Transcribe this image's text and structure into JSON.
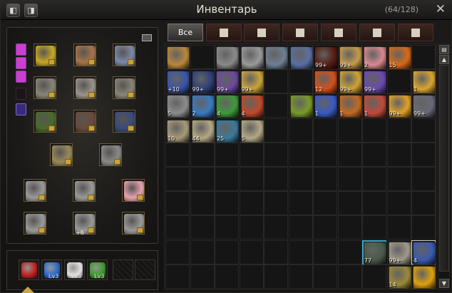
{
  "window": {
    "title": "Инвентарь",
    "capacity": "(64/128)",
    "close_glyph": "✕",
    "left_button_glyph": "◧",
    "right_button_glyph": "◨"
  },
  "tabs": [
    {
      "label": "Все",
      "icon": "all-items",
      "active": true
    },
    {
      "label": "",
      "icon": "helmet-icon",
      "active": false
    },
    {
      "label": "",
      "icon": "potion-icon",
      "active": false
    },
    {
      "label": "",
      "icon": "scroll-icon",
      "active": false
    },
    {
      "label": "",
      "icon": "box-icon",
      "active": false
    },
    {
      "label": "",
      "icon": "key-icon",
      "active": false
    },
    {
      "label": "",
      "icon": "crystal-icon",
      "active": false
    }
  ],
  "inventory": [
    {
      "r": 0,
      "c": 0,
      "color": "#b9873a",
      "qty": ""
    },
    {
      "r": 0,
      "c": 2,
      "color": "#8a8a8a",
      "qty": ""
    },
    {
      "r": 0,
      "c": 3,
      "color": "#9a9a9a",
      "qty": ""
    },
    {
      "r": 0,
      "c": 4,
      "color": "#6f7f92",
      "qty": ""
    },
    {
      "r": 0,
      "c": 5,
      "color": "#5a6fa2",
      "qty": ""
    },
    {
      "r": 0,
      "c": 6,
      "color": "#5a1f14",
      "qty": "99+"
    },
    {
      "r": 0,
      "c": 7,
      "color": "#c89b4a",
      "qty": "99+"
    },
    {
      "r": 0,
      "c": 8,
      "color": "#d88a8f",
      "qty": "2"
    },
    {
      "r": 0,
      "c": 9,
      "color": "#d86a18",
      "qty": "15"
    },
    {
      "r": 1,
      "c": 0,
      "color": "#3b55a8",
      "qty": "+10"
    },
    {
      "r": 1,
      "c": 1,
      "color": "#2f3f7a",
      "qty": "99+"
    },
    {
      "r": 1,
      "c": 2,
      "color": "#6a4a9a",
      "qty": "99+"
    },
    {
      "r": 1,
      "c": 3,
      "color": "#caa43a",
      "qty": "99+"
    },
    {
      "r": 1,
      "c": 6,
      "color": "#d4501a",
      "qty": "12"
    },
    {
      "r": 1,
      "c": 7,
      "color": "#cfa236",
      "qty": "99+"
    },
    {
      "r": 1,
      "c": 8,
      "color": "#6a4ab0",
      "qty": "99+"
    },
    {
      "r": 1,
      "c": 10,
      "color": "#d9a52f",
      "qty": "1"
    },
    {
      "r": 2,
      "c": 0,
      "color": "#8c8c8c",
      "qty": "5"
    },
    {
      "r": 2,
      "c": 1,
      "color": "#3a7ac0",
      "qty": "2"
    },
    {
      "r": 2,
      "c": 2,
      "color": "#3f9a3a",
      "qty": "4"
    },
    {
      "r": 2,
      "c": 3,
      "color": "#c04a2a",
      "qty": "4"
    },
    {
      "r": 2,
      "c": 5,
      "color": "#7a9a2a",
      "qty": ""
    },
    {
      "r": 2,
      "c": 6,
      "color": "#3a5ac0",
      "qty": "1"
    },
    {
      "r": 2,
      "c": 7,
      "color": "#c46a22",
      "qty": "1"
    },
    {
      "r": 2,
      "c": 8,
      "color": "#c04a3a",
      "qty": "1"
    },
    {
      "r": 2,
      "c": 9,
      "color": "#e0a02a",
      "qty": "99+"
    },
    {
      "r": 2,
      "c": 10,
      "color": "#6a6a78",
      "qty": "99+"
    },
    {
      "r": 3,
      "c": 0,
      "color": "#a89a7a",
      "qty": "10"
    },
    {
      "r": 3,
      "c": 1,
      "color": "#b4a884",
      "qty": "44"
    },
    {
      "r": 3,
      "c": 2,
      "color": "#3a7a9a",
      "qty": "25"
    },
    {
      "r": 3,
      "c": 3,
      "color": "#b4a884",
      "qty": "5"
    },
    {
      "r": 8,
      "c": 8,
      "color": "#4a5a4a",
      "qty": "77"
    },
    {
      "r": 8,
      "c": 9,
      "color": "#a09a8a",
      "qty": "99+"
    },
    {
      "r": 8,
      "c": 10,
      "color": "#3a5ab0",
      "qty": "4"
    },
    {
      "r": 9,
      "c": 9,
      "color": "#9a8a3a",
      "qty": "14"
    },
    {
      "r": 9,
      "c": 10,
      "color": "#e0a010",
      "qty": ""
    }
  ],
  "equipment": [
    {
      "name": "mask",
      "color": "#c9a824"
    },
    {
      "name": "hat",
      "color": "#a8744a"
    },
    {
      "name": "wings",
      "color": "#7a8aa8"
    },
    {
      "name": "gloves",
      "color": "#8a8478"
    },
    {
      "name": "armor",
      "color": "#9a948a"
    },
    {
      "name": "boots",
      "color": "#8a8478"
    },
    {
      "name": "cloak",
      "color": "#4a6a2a"
    },
    {
      "name": "pants",
      "color": "#6a4a3a"
    },
    {
      "name": "shield",
      "color": "#3a4a7a"
    },
    {
      "name": "weapon",
      "color": "#9a8a5a"
    },
    {
      "name": "offhand",
      "color": "#8a8a8a"
    },
    {
      "name": "necklace",
      "color": "#9a9a9a"
    },
    {
      "name": "earring",
      "color": "#9a9a9a"
    },
    {
      "name": "shirt",
      "color": "#e8a0b0"
    },
    {
      "name": "ring-left",
      "color": "#9a9a9a"
    },
    {
      "name": "bracelet",
      "color": "#9a9a9a"
    },
    {
      "name": "ring-right",
      "color": "#9a9a9a"
    }
  ],
  "equipment_labels": {
    "bracelet_enchant": "+6"
  },
  "gems": [
    {
      "color": "#c02020",
      "lv": ""
    },
    {
      "color": "#2a6ad0",
      "lv": "Lv3"
    },
    {
      "color": "#e0e0e0",
      "lv": "Lv3"
    },
    {
      "color": "#3a9a2a",
      "lv": "Lv3"
    }
  ]
}
